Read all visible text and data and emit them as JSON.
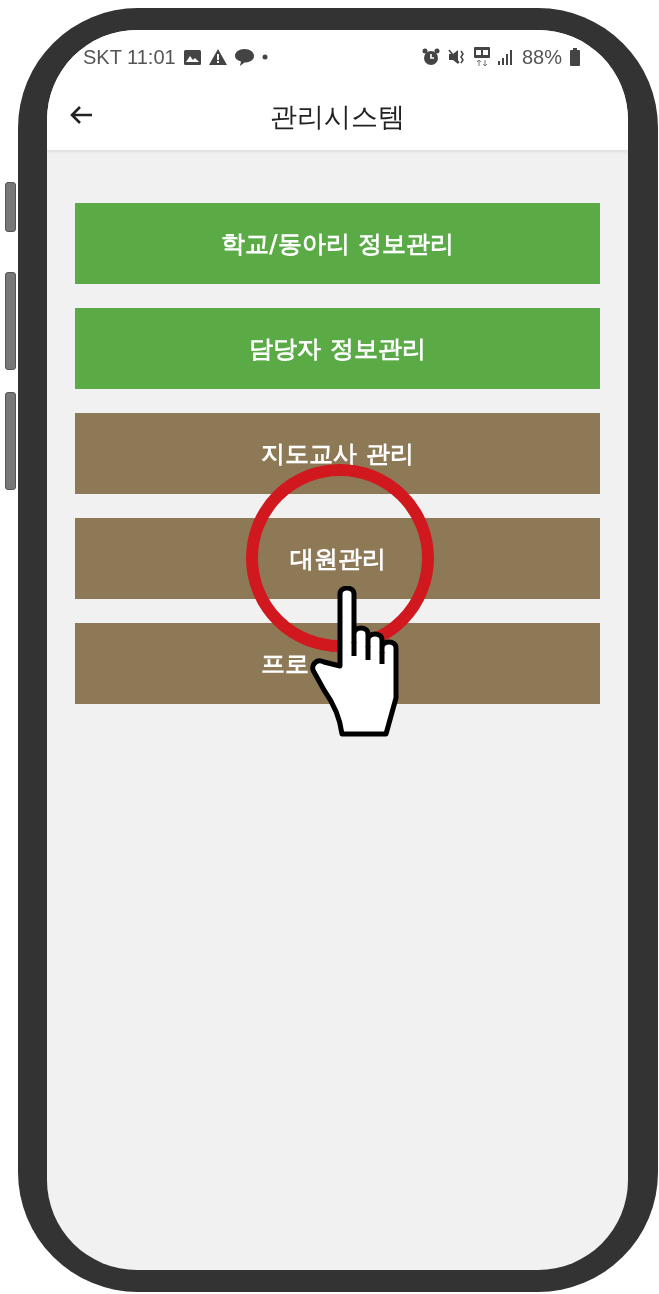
{
  "status_bar": {
    "carrier_time": "SKT 11:01",
    "battery": "88%"
  },
  "app_bar": {
    "title": "관리시스템"
  },
  "menu": [
    {
      "label": "학교/동아리 정보관리",
      "color": "#5aab46",
      "highlighted": false
    },
    {
      "label": "담당자 정보관리",
      "color": "#5aab46",
      "highlighted": false
    },
    {
      "label": "지도교사 관리",
      "color": "#8e7956",
      "highlighted": false
    },
    {
      "label": "대원관리",
      "color": "#8e7956",
      "highlighted": true
    },
    {
      "label": "프로",
      "color": "#8e7956",
      "highlighted": false
    }
  ]
}
